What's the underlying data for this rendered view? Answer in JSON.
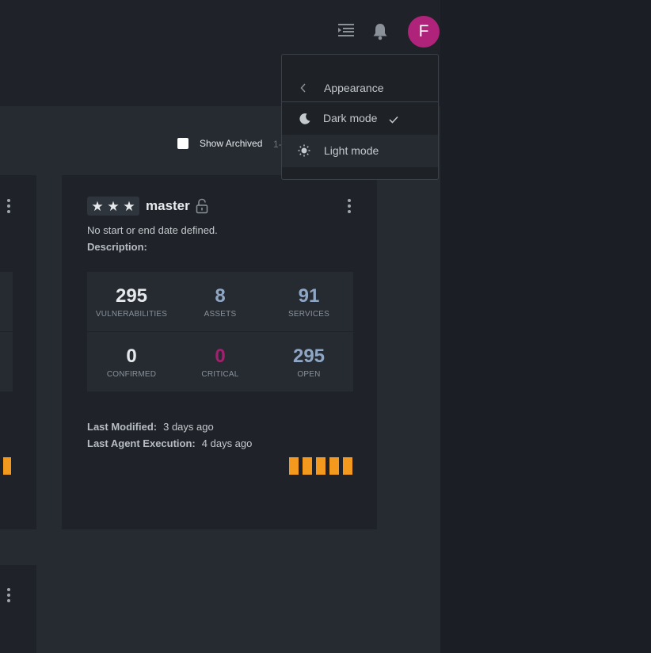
{
  "header": {
    "avatar_initial": "F",
    "list_icon": "list-icon",
    "bell_icon": "bell-icon"
  },
  "appearance_menu": {
    "title": "Appearance",
    "back_icon": "chevron-left-icon",
    "items": [
      {
        "label": "Dark mode",
        "icon": "moon-icon",
        "selected": true
      },
      {
        "label": "Light mode",
        "icon": "sun-icon",
        "selected": false
      }
    ]
  },
  "toolbar": {
    "show_archived_label": "Show Archived",
    "show_archived_checked": false,
    "pagination_text": "1-"
  },
  "workspace": {
    "stars": [
      "★",
      "★",
      "★"
    ],
    "name": "master",
    "lock_icon": "unlock-icon",
    "dates_text": "No start or end date defined.",
    "description_label": "Description:",
    "stats": [
      {
        "value": "295",
        "label": "VULNERABILITIES",
        "color": "#e6e9ec"
      },
      {
        "value": "8",
        "label": "ASSETS",
        "color": "#8fa6c4"
      },
      {
        "value": "91",
        "label": "SERVICES",
        "color": "#8fa6c4"
      },
      {
        "value": "0",
        "label": "CONFIRMED",
        "color": "#e6e9ec"
      },
      {
        "value": "0",
        "label": "CRITICAL",
        "color": "#a3206f"
      },
      {
        "value": "295",
        "label": "OPEN",
        "color": "#8fa6c4"
      }
    ],
    "last_modified_label": "Last Modified:",
    "last_modified_value": "3 days ago",
    "last_agent_label": "Last Agent Execution:",
    "last_agent_value": "4 days ago",
    "activity_bars": 5
  },
  "colors": {
    "accent_orange": "#f39a1e",
    "avatar": "#b0237a",
    "critical": "#a3206f"
  }
}
